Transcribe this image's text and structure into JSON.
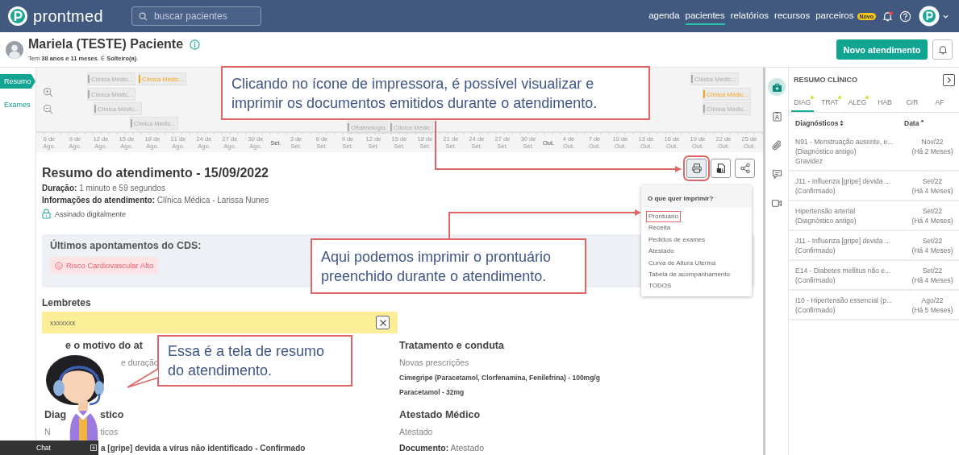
{
  "header": {
    "logo": "prontmed",
    "search": {
      "placeholder": "buscar pacientes"
    },
    "notifications_unread": true,
    "nav": [
      {
        "label": "agenda",
        "selected": false
      },
      {
        "label": "pacientes",
        "selected": true
      },
      {
        "label": "relatórios",
        "selected": false
      },
      {
        "label": "recursos",
        "selected": false
      },
      {
        "label": "parceiros",
        "selected": false,
        "badge": "Novo"
      }
    ]
  },
  "patient": {
    "name": "Mariela (TESTE) Paciente",
    "summary": "Tem **38 anos e 11 meses**. É **Solteiro(a)**.",
    "new_button": "Novo atendimento"
  },
  "left_tabs": [
    {
      "label": "Resumo",
      "selected": true
    },
    {
      "label": "Exames",
      "selected": false
    }
  ],
  "timeline": {
    "events": [
      {
        "label": "Clínica Médic...",
        "color": "#aaaaaa"
      },
      {
        "label": "Clínica Médic...",
        "color": "#f5a623"
      },
      {
        "label": "Clínica Médic...",
        "color": "#aaaaaa"
      },
      {
        "label": "Clínica Médic...",
        "color": "#aaaaaa"
      },
      {
        "label": "Clínica Médic...",
        "color": "#aaaaaa"
      },
      {
        "label": "Oftalmologia",
        "color": "#aaaaaa"
      },
      {
        "label": "Clínica Médic",
        "color": "#aaaaaa"
      },
      {
        "label": "Clínica Médic...",
        "color": "#aaaaaa"
      },
      {
        "label": "Clínica Médic...",
        "color": "#f5a623"
      },
      {
        "label": "Clínica Médic...",
        "color": "#aaaaaa"
      }
    ],
    "ticks": [
      {
        "kind": "day",
        "day": "6 de",
        "month": "Ago."
      },
      {
        "kind": "day",
        "day": "9 de",
        "month": "Ago."
      },
      {
        "kind": "day",
        "day": "12 de",
        "month": "Ago."
      },
      {
        "kind": "day",
        "day": "15 de",
        "month": "Ago."
      },
      {
        "kind": "day",
        "day": "18 de",
        "month": "Ago."
      },
      {
        "kind": "day",
        "day": "21 de",
        "month": "Ago."
      },
      {
        "kind": "day",
        "day": "24 de",
        "month": "Ago."
      },
      {
        "kind": "day",
        "day": "27 de",
        "month": "Ago."
      },
      {
        "kind": "day",
        "day": "30 de",
        "month": "Ago."
      },
      {
        "kind": "month",
        "label": "Set."
      },
      {
        "kind": "day",
        "day": "3 de",
        "month": "Set."
      },
      {
        "kind": "day",
        "day": "6 de",
        "month": "Set."
      },
      {
        "kind": "day",
        "day": "9 de",
        "month": "Set."
      },
      {
        "kind": "day",
        "day": "12 de",
        "month": "Set."
      },
      {
        "kind": "day",
        "day": "15 de",
        "month": "Set."
      },
      {
        "kind": "day",
        "day": "18 de",
        "month": "Set."
      },
      {
        "kind": "day",
        "day": "21 de",
        "month": "Set."
      },
      {
        "kind": "day",
        "day": "24 de",
        "month": "Set."
      },
      {
        "kind": "day",
        "day": "27 de",
        "month": "Set."
      },
      {
        "kind": "day",
        "day": "30 de",
        "month": "Set."
      },
      {
        "kind": "month",
        "label": "Out."
      },
      {
        "kind": "day",
        "day": "4 de",
        "month": "Out."
      },
      {
        "kind": "day",
        "day": "7 de",
        "month": "Out."
      },
      {
        "kind": "day",
        "day": "10 de",
        "month": "Out."
      },
      {
        "kind": "day",
        "day": "13 de",
        "month": "Out."
      },
      {
        "kind": "day",
        "day": "16 de",
        "month": "Out."
      },
      {
        "kind": "day",
        "day": "19 de",
        "month": "Out."
      },
      {
        "kind": "day",
        "day": "22 de",
        "month": "Out."
      },
      {
        "kind": "day",
        "day": "25 de",
        "month": "Out."
      }
    ]
  },
  "summary": {
    "title": "Resumo do atendimento - 15/09/2022",
    "duration": "**Duração:** 1 minuto e 59 segundos",
    "info": "**Informações do atendimento:** Clínica Médica - Larissa Nunes",
    "signed": "Assinado digitalmente",
    "actions": [
      {
        "kind": "print",
        "highlighted": true
      },
      {
        "kind": "document",
        "highlighted": false
      },
      {
        "kind": "share",
        "highlighted": false
      }
    ],
    "print_menu": {
      "title": "O que quer imprimir?",
      "items": [
        {
          "label": "Prontuário",
          "highlighted": true
        },
        {
          "label": "Receita",
          "highlighted": false
        },
        {
          "label": "Pedidos de exames",
          "highlighted": false
        },
        {
          "label": "Atestado",
          "highlighted": false
        },
        {
          "label": "Curva de Altura Uterina",
          "highlighted": false
        },
        {
          "label": "Tabela de acompanhamento",
          "highlighted": false
        },
        {
          "label": "TODOS",
          "highlighted": false
        }
      ]
    },
    "cds": {
      "title": "Últimos apontamentos do CDS:",
      "alerts": [
        "Risco Cardiovascular Alto"
      ]
    },
    "reminders": {
      "title": "Lembretes",
      "items": [
        "xxxxxxx"
      ]
    },
    "complaint": {
      "title": "e o motivo do at",
      "text": "e duração"
    },
    "diagnosis": {
      "title_parts": [
        "Diag",
        "stico"
      ],
      "subtitle_parts": [
        "N",
        "ticos"
      ],
      "item": "a [gripe] devida a vírus não identificado - Confirmado"
    },
    "treatment": {
      "title": "Tratamento e conduta",
      "subtitle": "Novas prescrições",
      "items": [
        "Cimegripe (Paracetamol, Clorfenamina, Fenilefrina) - 100mg/g",
        "Paracetamol - 32mg"
      ]
    },
    "certificate": {
      "title": "Atestado Médico",
      "subtitle": "Atestado",
      "document": "**Documento:** Atestado"
    }
  },
  "side_tools": [
    {
      "selected": true
    },
    {
      "selected": false
    },
    {
      "selected": false
    },
    {
      "selected": false
    },
    {
      "selected": false
    }
  ],
  "clinical_summary": {
    "title": "RESUMO CLÍNICO",
    "tabs": [
      {
        "label": "DIAG",
        "selected": true,
        "dot": true
      },
      {
        "label": "TRAT",
        "selected": false,
        "dot": true
      },
      {
        "label": "ALEG",
        "selected": false,
        "dot": true
      },
      {
        "label": "HAB",
        "selected": false,
        "dot": false
      },
      {
        "label": "CIR",
        "selected": false,
        "dot": false
      },
      {
        "label": "AF",
        "selected": false,
        "dot": false
      }
    ],
    "columns": [
      "Diagnósticos",
      "Data"
    ],
    "rows": [
      {
        "lines": [
          "N91 - Menstruação ausente, e...",
          "(Diagnóstico antigo)",
          "Gravidez"
        ],
        "date": "Nov/22",
        "ago": "(Há 2 Meses)"
      },
      {
        "lines": [
          "J11 - Influenza [gripe] devida ...",
          "(Confirmado)"
        ],
        "date": "Set/22",
        "ago": "(Há 4 Meses)"
      },
      {
        "lines": [
          "Hipertensão arterial",
          "(Diagnóstico antigo)"
        ],
        "date": "Set/22",
        "ago": "(Há 4 Meses)"
      },
      {
        "lines": [
          "J11 - Influenza [gripe] devida ...",
          "(Confirmado)"
        ],
        "date": "Set/22",
        "ago": "(Há 4 Meses)"
      },
      {
        "lines": [
          "E14 - Diabetes mellitus não e...",
          "(Confirmado)"
        ],
        "date": "Set/22",
        "ago": "(Há 4 Meses)"
      },
      {
        "lines": [
          "I10 - Hipertensão essencial (p...",
          "(Confirmado)"
        ],
        "date": "Ago/22",
        "ago": "(Há 5 Meses)"
      }
    ]
  },
  "callouts": [
    {
      "text": "Clicando no ícone de impressora, é possível visualizar e imprimir os documentos emitidos durante o atendimento."
    },
    {
      "text": "Aqui podemos imprimir o prontuário preenchido durante o atendimento."
    },
    {
      "text": "Essa é a tela de resumo do atendimento."
    }
  ],
  "chat": {
    "label": "Chat"
  }
}
